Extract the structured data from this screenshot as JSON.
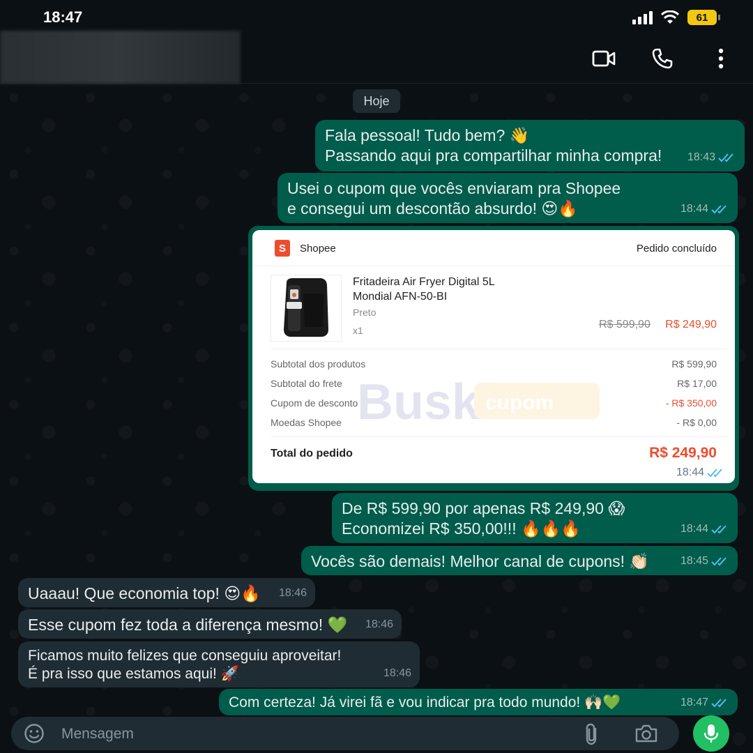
{
  "status_bar": {
    "time": "18:47",
    "battery": "61"
  },
  "header": {
    "video_call_icon": "video-camera-icon",
    "voice_call_icon": "phone-icon",
    "menu_icon": "more-vertical-icon"
  },
  "date_chip": "Hoje",
  "messages": [
    {
      "dir": "out",
      "lines": [
        "Fala pessoal! Tudo bem? 👋",
        "Passando aqui pra compartilhar minha compra!"
      ],
      "time": "18:43"
    },
    {
      "dir": "out",
      "lines": [
        "Usei o cupom que vocês enviaram pra Shopee",
        "e consegui um descontão absurdo! 😍🔥"
      ],
      "time": "18:44"
    },
    {
      "dir": "out",
      "type": "image",
      "time": "18:44"
    },
    {
      "dir": "out",
      "lines": [
        "De R$ 599,90 por apenas R$ 249,90 😱",
        "Economizei R$ 350,00!!! 🔥🔥🔥"
      ],
      "time": "18:44"
    },
    {
      "dir": "out",
      "lines": [
        "Vocês são demais! Melhor canal de cupons! 👏🏻"
      ],
      "time": "18:45"
    },
    {
      "dir": "in",
      "lines": [
        "Uaaau! Que economia top! 😍🔥"
      ],
      "time": "18:46"
    },
    {
      "dir": "in",
      "lines": [
        "Esse cupom fez toda a diferença mesmo! 💚"
      ],
      "time": "18:46"
    },
    {
      "dir": "in",
      "lines": [
        "Ficamos muito felizes que conseguiu aproveitar!",
        "É pra isso que estamos aqui! 🚀"
      ],
      "time": "18:46"
    },
    {
      "dir": "out",
      "lines": [
        "Com certeza! Já virei fã e vou indicar pra todo mundo! 🙌🏻💚"
      ],
      "time": "18:47"
    }
  ],
  "order_card": {
    "store": "Shopee",
    "status": "Pedido concluído",
    "product_name_line1": "Fritadeira Air Fryer Digital 5L",
    "product_name_line2": "Mondial AFN-50-BI",
    "variant": "Preto",
    "quantity": "x1",
    "old_price": "R$ 599,90",
    "new_price": "R$ 249,90",
    "summary": [
      {
        "label": "Subtotal dos produtos",
        "value": "R$ 599,90",
        "accent": false
      },
      {
        "label": "Subtotal do frete",
        "value": "R$ 17,00",
        "accent": false
      },
      {
        "label": "Cupom de desconto",
        "value": "- R$ 350,00",
        "accent": true
      },
      {
        "label": "Moedas Shopee",
        "value": "- R$ 0,00",
        "accent": false
      }
    ],
    "total_label": "Total do pedido",
    "total_value": "R$ 249,90",
    "watermark_word": "Busk",
    "watermark_tag": "cupom"
  },
  "composer": {
    "placeholder": "Mensagem"
  },
  "colors": {
    "outgoing": "#005c4b",
    "incoming": "#202c33",
    "shopee": "#ee4d2d",
    "read_ticks": "#53bdeb",
    "mic": "#21c063"
  }
}
